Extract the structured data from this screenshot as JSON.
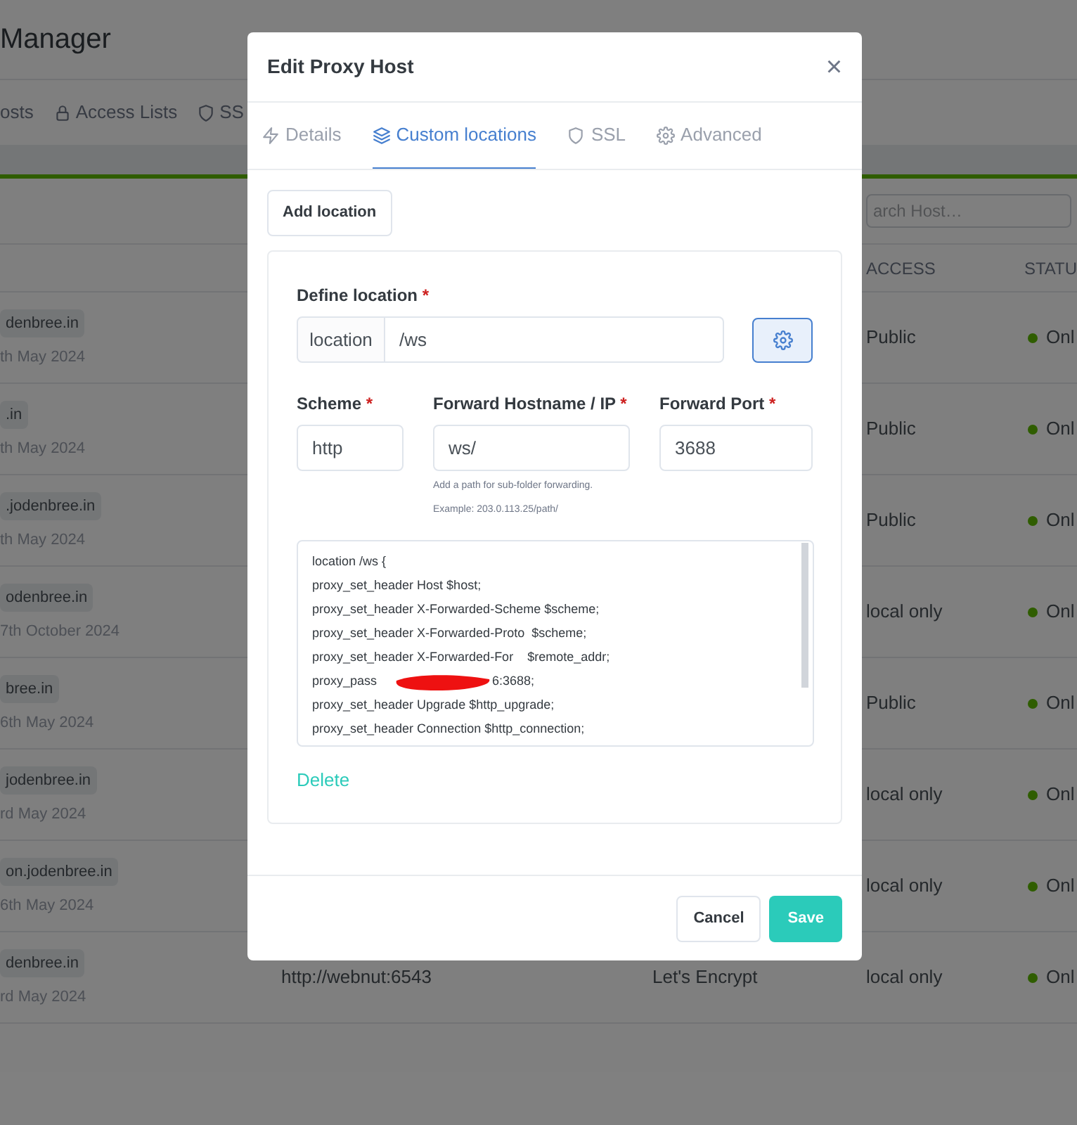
{
  "app": {
    "title": "Manager",
    "nav": [
      {
        "label": "osts",
        "kind": "plain"
      },
      {
        "label": "Access Lists",
        "kind": "lock"
      },
      {
        "label": "SS",
        "kind": "shield"
      }
    ],
    "search": {
      "placeholder": "arch Host…"
    },
    "columns": [
      "ACCESS",
      "STATU"
    ],
    "rows": [
      {
        "domain": "denbree.in",
        "date": "th May 2024",
        "access": "Public",
        "status": "Onl"
      },
      {
        "domain": ".in",
        "date": "th May 2024",
        "access": "Public",
        "status": "Onl"
      },
      {
        "domain": ".jodenbree.in",
        "date": "th May 2024",
        "access": "Public",
        "status": "Onl"
      },
      {
        "domain": "odenbree.in",
        "date": "7th October 2024",
        "access": "local only",
        "status": "Onl"
      },
      {
        "domain": "bree.in",
        "date": "6th May 2024",
        "access": "Public",
        "status": "Onl"
      },
      {
        "domain": "jodenbree.in",
        "date": "rd May 2024",
        "access": "local only",
        "status": "Onl"
      },
      {
        "domain": "on.jodenbree.in",
        "date": "6th May 2024",
        "access": "local only",
        "status": "Onl"
      },
      {
        "domain": "denbree.in",
        "date": "rd May 2024",
        "destination": "http://webnut:6543",
        "ssl": "Let's Encrypt",
        "access": "local only",
        "status": "Onl"
      }
    ]
  },
  "modal": {
    "title": "Edit Proxy Host",
    "close": "×",
    "tabs": [
      {
        "label": "Details",
        "kind": "bolt",
        "selected": false
      },
      {
        "label": "Custom locations",
        "kind": "layers",
        "selected": true
      },
      {
        "label": "SSL",
        "kind": "shield",
        "selected": false
      },
      {
        "label": "Advanced",
        "kind": "gear",
        "selected": false
      }
    ],
    "add_button": "Add location",
    "location": {
      "label": "Define location",
      "required": "*",
      "addon": "location",
      "value": "/ws"
    },
    "scheme": {
      "label": "Scheme",
      "required": "*",
      "value": "http"
    },
    "hostname": {
      "label": "Forward Hostname / IP",
      "required": "*",
      "value": "ws/",
      "help": [
        "Add a path for sub-folder forwarding.",
        "Example: 203.0.113.25/path/"
      ]
    },
    "port": {
      "label": "Forward Port",
      "required": "*",
      "value": "3688"
    },
    "config": [
      {
        "kind": "text",
        "text": "location /ws {"
      },
      {
        "kind": "text",
        "text": "proxy_set_header Host $host;"
      },
      {
        "kind": "text",
        "text": "proxy_set_header X-Forwarded-Scheme $scheme;"
      },
      {
        "kind": "text",
        "text": "proxy_set_header X-Forwarded-Proto  $scheme;"
      },
      {
        "kind": "text",
        "text": "proxy_set_header X-Forwarded-For    $remote_addr;"
      },
      {
        "kind": "redacted",
        "before": "proxy_pass",
        "after": "6:3688;"
      },
      {
        "kind": "text",
        "text": "proxy_set_header Upgrade $http_upgrade;"
      },
      {
        "kind": "text",
        "text": "proxy_set_header Connection $http_connection;"
      }
    ],
    "delete": "Delete",
    "cancel": "Cancel",
    "save": "Save"
  }
}
